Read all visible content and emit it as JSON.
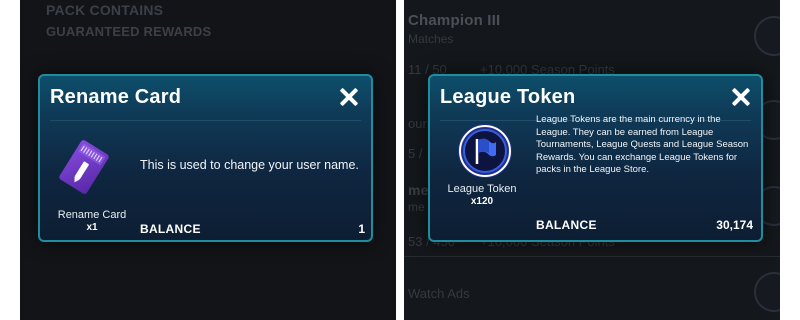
{
  "left": {
    "background": {
      "pack_contains": "PACK CONTAINS",
      "guaranteed_rewards": "GUARANTEED REWARDS"
    },
    "modal": {
      "title": "Rename Card",
      "close_icon": "close-icon",
      "item_icon": "rename-ticket-icon",
      "item_name": "Rename Card",
      "item_quantity": "x1",
      "description": "This is used to change your user name.",
      "balance_label": "BALANCE",
      "balance_value": "1"
    }
  },
  "right": {
    "background": {
      "rank_title": "Champion III",
      "matches_label": "Matches",
      "row1_progress": "11 / 50",
      "row1_reward": "+10,000 Season Points",
      "row2_fragment": "ourr",
      "row3_progress": "5 / ",
      "row4_fragment_a": "mer",
      "row4_fragment_b": "me",
      "row5_progress": "53 / 450",
      "row5_reward": "+10,000 Season Points",
      "watch_ads": "Watch Ads"
    },
    "modal": {
      "title": "League Token",
      "close_icon": "close-icon",
      "item_icon": "league-flag-token-icon",
      "item_name": "League Token",
      "item_quantity": "x120",
      "description": "League Tokens are the main currency in the League. They can be earned from League Tournaments, League Quests and League Season Rewards. You can exchange League Tokens for packs in the League Store.",
      "balance_label": "BALANCE",
      "balance_value": "30,174"
    }
  },
  "colors": {
    "modal_border": "#1e8d9e",
    "modal_top": "#0d4f6b",
    "modal_bottom": "#0d1e33",
    "ticket_purple": "#7a3fd6",
    "token_ring": "#2a4fc9"
  }
}
